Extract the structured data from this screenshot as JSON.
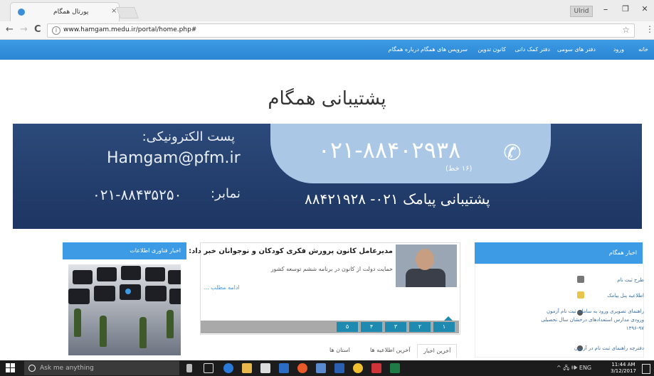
{
  "browser": {
    "tab_title": "پورتال همگام",
    "tab_close": "×",
    "user_button": "Ulrid",
    "win_min": "–",
    "win_max": "❐",
    "win_close": "✕",
    "back": "←",
    "forward": "→",
    "reload": "C",
    "url": "www.hamgam.medu.ir/portal/home.php#",
    "star": "☆",
    "menu": "⋮"
  },
  "site_nav": {
    "items": [
      "خانه",
      "ورود",
      "دفتر های سومی",
      "دفتر کمک دانی",
      "کانون تدوین",
      "سرویس های همگام",
      "درباره همگام"
    ]
  },
  "header": {
    "title": "پشتیبانی همگام"
  },
  "banner": {
    "phone": "۰۲۱-۸۸۴۰۲۹۳۸",
    "phone_note": "(۱۶ خط)",
    "email_label": "پست الکترونیکی:",
    "email": "Hamgam@pfm.ir",
    "fax_label": "نمابر:",
    "fax": "۰۲۱-۸۸۴۳۵۲۵۰",
    "sms": "پشتیبانی پیامک  ۰۲۱- ۸۸۴۲۱۹۲۸"
  },
  "left_box": {
    "title": "اخبار فناوری اطلاعات"
  },
  "news": {
    "title": "مدیرعامل کانون پرورش فکری کودکان و نوجوانان خبر داد:",
    "subtitle": "حمایت دولت از کانون در برنامه ششم توسعه کشور",
    "read_more": "ادامه مطلب ...",
    "pages": [
      "۱",
      "۲",
      "۳",
      "۴",
      "۵"
    ],
    "tabs": [
      "آخرین اخبار",
      "آخرین اطلاعیه ها",
      "استان ها"
    ]
  },
  "right_panel": {
    "title": "اخبار همگام",
    "items": [
      "طرح ثبت نام",
      "اطلاعیه پنل پیامک",
      "راهنمای تصویری ورود به سامانه ثبت نام آزمون ورودی مدارس استعدادهای درخشان سال تحصیلی ۹۷-۱۳۹۶",
      "دفترچه راهنمای ثبت نام در آزمون"
    ]
  },
  "taskbar": {
    "search_placeholder": "Ask me anything",
    "time": "11:44 AM",
    "date": "3/12/2017",
    "tray": "^ 🖧 🕪 ENG"
  },
  "colors": {
    "accent": "#3d9be5",
    "banner": "#1d3562",
    "banner_pill": "#aac8e6",
    "pager": "#1f8ab0"
  }
}
